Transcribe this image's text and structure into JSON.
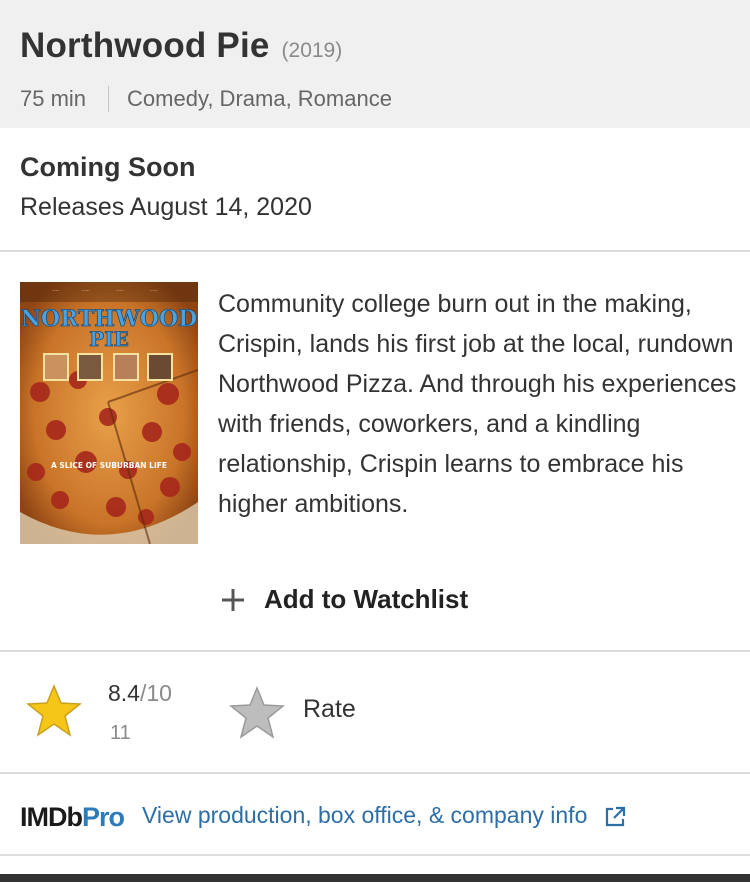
{
  "header": {
    "title": "Northwood Pie",
    "year": "(2019)",
    "runtime": "75 min",
    "genres": "Comedy, Drama, Romance"
  },
  "status": {
    "title": "Coming Soon",
    "release": "Releases August 14, 2020"
  },
  "poster": {
    "title_line1": "NORTHWOOD",
    "title_line2": "PIE",
    "tagline": "A SLICE OF SUBURBAN LIFE"
  },
  "plot": {
    "text": "Community college burn out in the making, Crispin, lands his first job at the local, rundown Northwood Pizza. And through his experiences with friends, coworkers, and a kindling relationship, Crispin learns to embrace his higher ambitions."
  },
  "watchlist": {
    "label": "Add to Watchlist",
    "icon": "plus-icon"
  },
  "rating": {
    "value": "8.4",
    "max": "/10",
    "count": "11",
    "rate_label": "Rate"
  },
  "imdbpro": {
    "logo_imdb": "IMDb",
    "logo_pro": "Pro",
    "link_text": "View production, box office, & company info"
  },
  "colors": {
    "header_bg": "#f0f0f0",
    "star_gold": "#f5c518",
    "link_blue": "#2d6ea6",
    "pro_blue": "#2d7bb9"
  }
}
